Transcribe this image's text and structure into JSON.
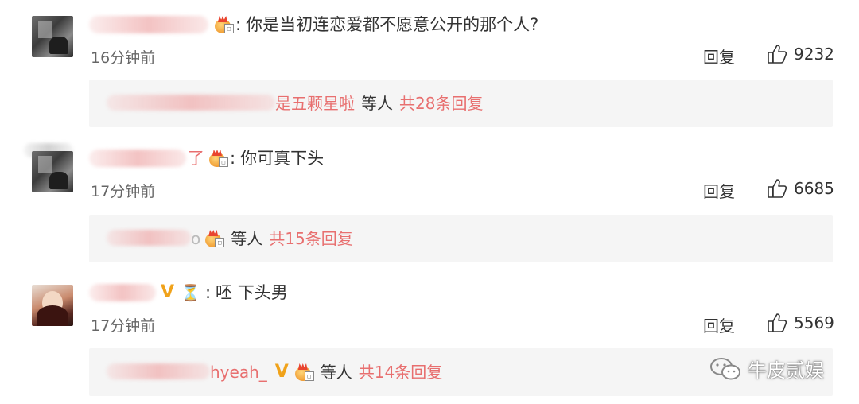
{
  "comments": [
    {
      "text": "你是当初连恋爱都不愿意公开的那个人?",
      "time": "16分钟前",
      "reply_label": "回复",
      "likes": "9232",
      "sub": {
        "tail_name": "是五颗星啦",
        "middle": "等人",
        "count": "共28条回复"
      }
    },
    {
      "name_tail": "了",
      "text": "你可真下头",
      "time": "17分钟前",
      "reply_label": "回复",
      "likes": "6685",
      "sub": {
        "tail_name": "o",
        "middle": "等人",
        "count": "共15条回复"
      }
    },
    {
      "text": "呸 下头男",
      "time": "17分钟前",
      "reply_label": "回复",
      "likes": "5569",
      "sub": {
        "tail_name": "hyeah_",
        "middle": "等人",
        "count": "共14条回复"
      }
    }
  ],
  "icons": {
    "crown_badge": "crown-badge-icon",
    "verified_badge": "V",
    "hourglass": "⏳",
    "like": "thumbs-up-icon",
    "wechat": "wechat-icon"
  },
  "colors": {
    "accent_pink": "#e86f6f",
    "verified_gold": "#f0a21a",
    "sub_bg": "#f5f5f5"
  },
  "watermark": "牛皮贰娱"
}
